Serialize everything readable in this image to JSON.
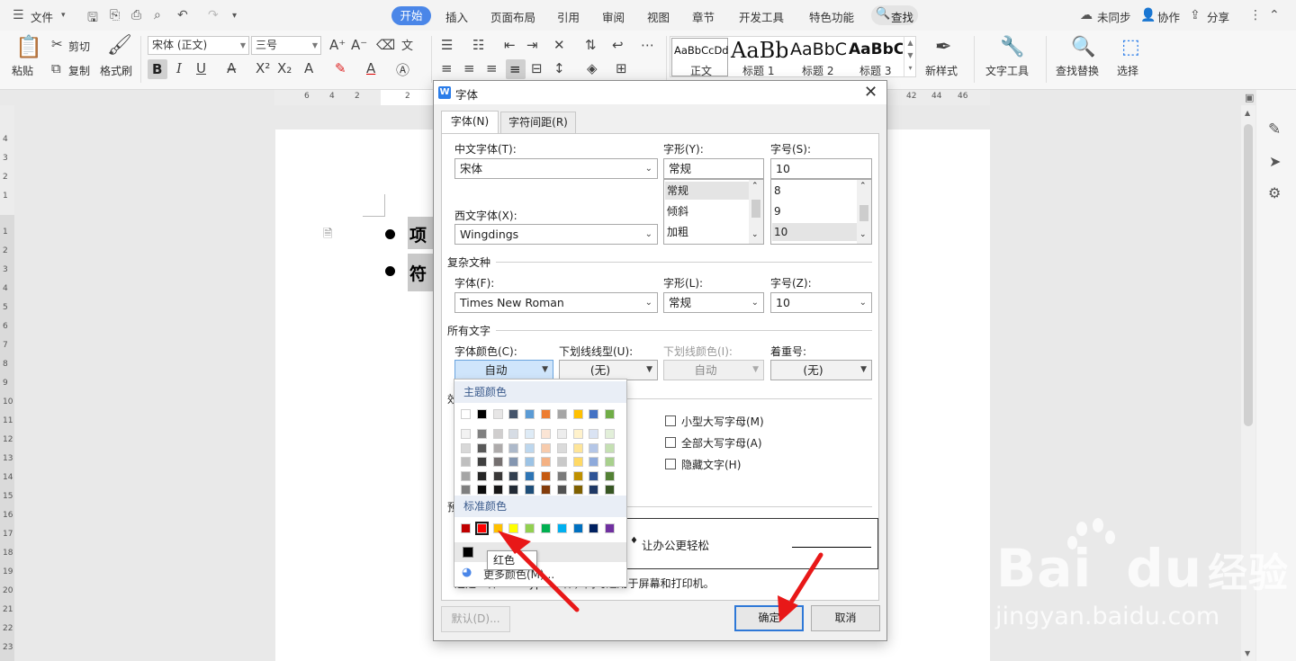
{
  "menubar": {
    "file": "文件",
    "tabs": [
      "开始",
      "插入",
      "页面布局",
      "引用",
      "审阅",
      "视图",
      "章节",
      "开发工具",
      "特色功能"
    ],
    "search": "查找",
    "sync": "未同步",
    "collab": "协作",
    "share": "分享"
  },
  "ribbon": {
    "paste": "粘贴",
    "cut": "剪切",
    "copy": "复制",
    "format_painter": "格式刷",
    "font_name": "宋体 (正文)",
    "font_size": "三号",
    "styles": [
      {
        "preview": "AaBbCcDd",
        "name": "正文"
      },
      {
        "preview": "AaBb",
        "name": "标题 1"
      },
      {
        "preview": "AaBbC",
        "name": "标题 2"
      },
      {
        "preview": "AaBbC",
        "name": "标题 3"
      }
    ],
    "new_style": "新样式",
    "text_tools": "文字工具",
    "find_replace": "查找替换",
    "select": "选择"
  },
  "ruler": {
    "h": [
      "6",
      "4",
      "2",
      "2",
      "42",
      "44",
      "46"
    ],
    "v": [
      "4",
      "3",
      "2",
      "1",
      "1",
      "2",
      "3",
      "4",
      "5",
      "6",
      "7",
      "8",
      "9",
      "10",
      "11",
      "12",
      "13",
      "14",
      "15",
      "16",
      "17",
      "18",
      "19",
      "20",
      "21",
      "22",
      "23"
    ]
  },
  "document": {
    "line1": "项",
    "line2": "符"
  },
  "dialog": {
    "title": "字体",
    "tab_font": "字体(N)",
    "tab_spacing": "字符间距(R)",
    "cn_font_label": "中文字体(T):",
    "cn_font_value": "宋体",
    "style_label": "字形(Y):",
    "style_value": "常规",
    "style_options": [
      "常规",
      "倾斜",
      "加粗"
    ],
    "size_label": "字号(S):",
    "size_value": "10",
    "size_options": [
      "8",
      "9",
      "10"
    ],
    "west_font_label": "西文字体(X):",
    "west_font_value": "Wingdings",
    "complex_title": "复杂文种",
    "cx_font_label": "字体(F):",
    "cx_font_value": "Times New Roman",
    "cx_style_label": "字形(L):",
    "cx_style_value": "常规",
    "cx_size_label": "字号(Z):",
    "cx_size_value": "10",
    "all_text_title": "所有文字",
    "color_label": "字体颜色(C):",
    "color_value": "自动",
    "underline_label": "下划线线型(U):",
    "underline_value": "(无)",
    "underline_color_label": "下划线颜色(I):",
    "underline_color_value": "自动",
    "emphasis_label": "着重号:",
    "emphasis_value": "(无)",
    "effects_title_partial": "效",
    "preview_title_partial": "预",
    "checkboxes": [
      "小型大写字母(M)",
      "全部大写字母(A)",
      "隐藏文字(H)"
    ],
    "preview_text": "让办公更轻松",
    "description": "这是一种 TrueType 字体，同时适用于屏幕和打印机。",
    "btn_default": "默认(D)...",
    "btn_ok": "确定",
    "btn_cancel": "取消"
  },
  "color_popup": {
    "theme_title": "主题颜色",
    "standard_title": "标准颜色",
    "more_colors": "更多颜色(M)...",
    "tooltip": "红色",
    "theme_top": [
      "#ffffff",
      "#000000",
      "#e7e6e6",
      "#44546a",
      "#5b9bd5",
      "#ed7d31",
      "#a5a5a5",
      "#ffc000",
      "#4472c4",
      "#70ad47"
    ],
    "theme_shades": [
      [
        "#f2f2f2",
        "#808080",
        "#d0cece",
        "#d6dce4",
        "#deebf6",
        "#fbe5d5",
        "#ededed",
        "#fff2cc",
        "#dae3f3",
        "#e2efd9"
      ],
      [
        "#d8d8d8",
        "#595959",
        "#aeabab",
        "#adb9ca",
        "#bdd7ee",
        "#f7cbac",
        "#dbdbdb",
        "#fee599",
        "#b4c6e7",
        "#c5e0b3"
      ],
      [
        "#bfbfbf",
        "#404040",
        "#757070",
        "#8496b0",
        "#9cc3e5",
        "#f4b183",
        "#c9c9c9",
        "#ffd965",
        "#8eaadb",
        "#a8d08d"
      ],
      [
        "#a5a5a5",
        "#262626",
        "#3a3838",
        "#323f4f",
        "#2e75b5",
        "#c55a11",
        "#7b7b7b",
        "#bf9000",
        "#2f5496",
        "#538135"
      ],
      [
        "#7f7f7f",
        "#0c0c0c",
        "#171616",
        "#222a35",
        "#1e4e79",
        "#833c0b",
        "#525252",
        "#7f6000",
        "#1f3864",
        "#375623"
      ]
    ],
    "standard": [
      "#c00000",
      "#ff0000",
      "#ffc000",
      "#ffff00",
      "#92d050",
      "#00b050",
      "#00b0f0",
      "#0070c0",
      "#002060",
      "#7030a0"
    ],
    "auto_swatch": "#000000"
  },
  "watermark": {
    "brand": "Bai",
    "brand2": "du",
    "brand_cn": "经验",
    "url": "jingyan.baidu.com"
  },
  "colors": {
    "accent": "#4a86e8",
    "arrow": "#e81818"
  }
}
